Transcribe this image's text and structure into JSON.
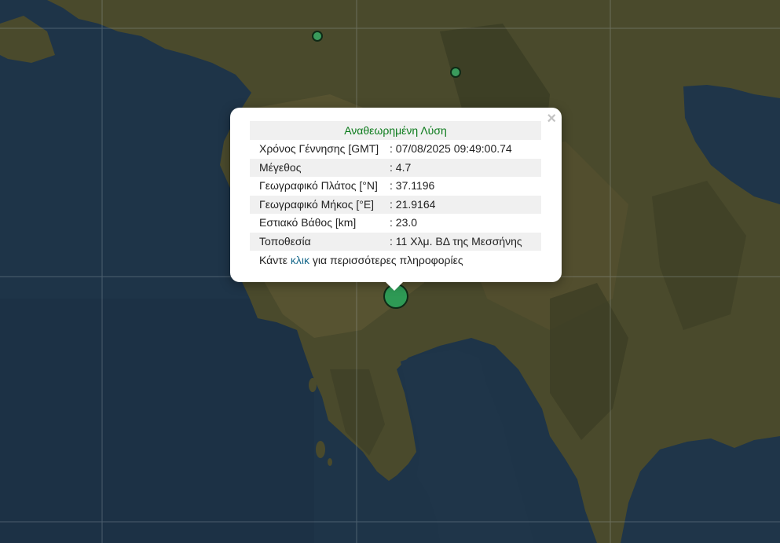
{
  "map": {
    "basemap": "satellite imagery",
    "markers": [
      {
        "name": "marker-small-north",
        "color": "#3a9b5c",
        "size": "small"
      },
      {
        "name": "marker-small-northeast",
        "color": "#3a9b5c",
        "size": "small"
      },
      {
        "name": "marker-selected-event",
        "color": "#2e9a55",
        "size": "large"
      }
    ]
  },
  "popup": {
    "title": "Αναθεωρημένη Λύση",
    "title_color": "#0a7a1a",
    "close_glyph": "×",
    "rows": [
      {
        "label": "Χρόνος Γέννησης [GMT]",
        "value": ": 07/08/2025 09:49:00.74"
      },
      {
        "label": "Μέγεθος",
        "value": ": 4.7"
      },
      {
        "label": "Γεωγραφικό Πλάτος [°N]",
        "value": ": 37.1196"
      },
      {
        "label": "Γεωγραφικό Μήκος [°E]",
        "value": ": 21.9164"
      },
      {
        "label": "Εστιακό Βάθος [km]",
        "value": ": 23.0"
      },
      {
        "label": "Τοποθεσία",
        "value": ": 11 Χλμ. ΒΔ της Μεσσήνης"
      }
    ],
    "footer": {
      "before": "Κάντε ",
      "link": "κλικ",
      "after": " για περισσότερες πληροφορίες"
    }
  }
}
